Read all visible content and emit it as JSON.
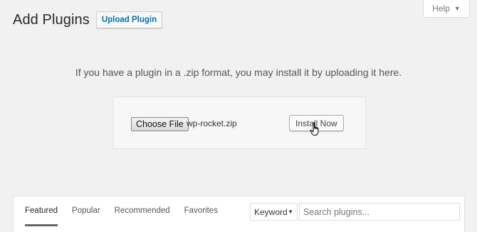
{
  "help_tab": {
    "label": "Help",
    "caret_icon": "caret-down-icon"
  },
  "header": {
    "title": "Add Plugins",
    "upload_label": "Upload Plugin"
  },
  "upload": {
    "info_text": "If you have a plugin in a .zip format, you may install it by uploading it here.",
    "choose_label": "Choose File",
    "file_name": "wp-rocket.zip",
    "install_label": "Install Now"
  },
  "filter": {
    "tabs": [
      {
        "label": "Featured",
        "active": true
      },
      {
        "label": "Popular"
      },
      {
        "label": "Recommended"
      },
      {
        "label": "Favorites"
      }
    ],
    "search_type": "Keyword",
    "search_placeholder": "Search plugins..."
  },
  "colors": {
    "accent": "#0073aa",
    "background": "#f1f1f1"
  }
}
